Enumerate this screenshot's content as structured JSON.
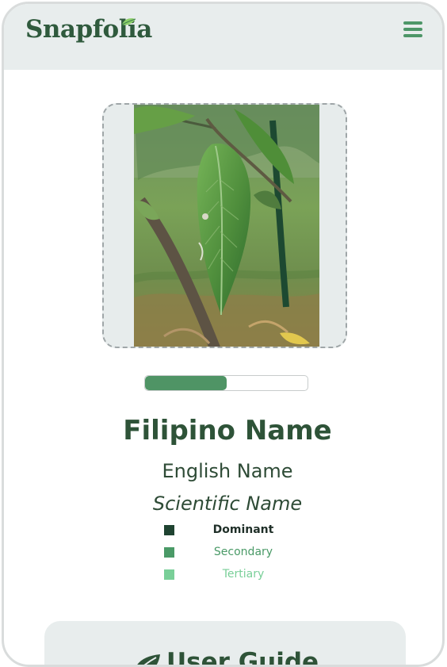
{
  "app": {
    "logo_text": "Snapfolia"
  },
  "colors": {
    "header_bg": "#e8eded",
    "brand_green": "#2f5a3d",
    "accent_green": "#4f9465",
    "dominant": "#1f4331",
    "secondary": "#4a9a67",
    "tertiary": "#79cf98"
  },
  "icons": {
    "menu": "hamburger-menu-icon",
    "guide": "leaf-icon"
  },
  "upload": {
    "progress_percent": 50
  },
  "plant": {
    "filipino_name": "Filipino Name",
    "english_name": "English Name",
    "scientific_name": "Scientific Name"
  },
  "legend": [
    {
      "label": "Dominant",
      "color": "#1f4331"
    },
    {
      "label": "Secondary",
      "color": "#4a9a67"
    },
    {
      "label": "Tertiary",
      "color": "#79cf98"
    }
  ],
  "guide": {
    "title": "User Guide"
  }
}
